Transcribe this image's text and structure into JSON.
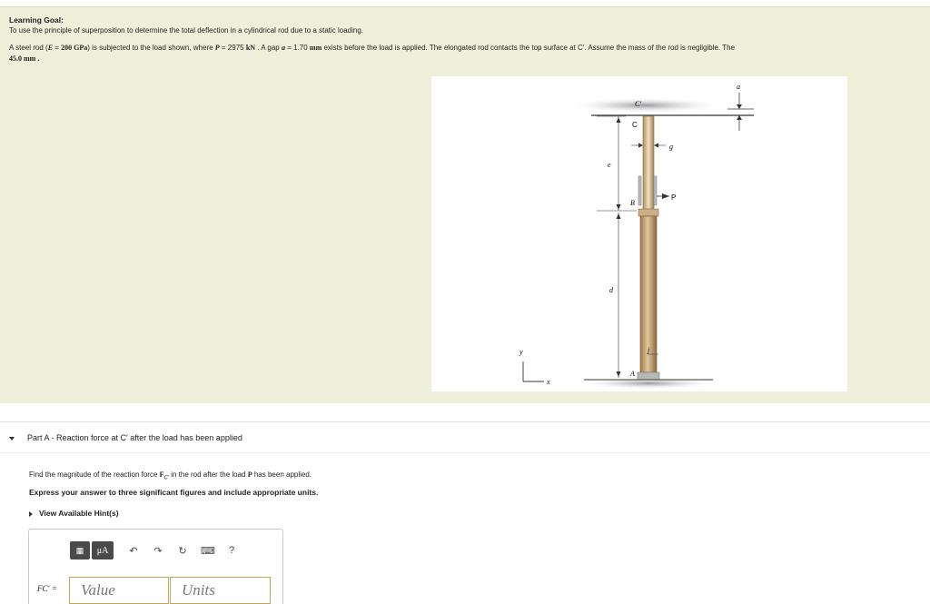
{
  "learning_goal": {
    "title": "Learning Goal:",
    "intro": "To use the principle of superposition to determine the total deflection in a cylindrical rod due to a static loading.",
    "problem": {
      "p1": "A steel rod (",
      "e_sym": "E",
      "p2": " = ",
      "e_val": "200 GPa",
      "p3": ") is subjected to the load shown, where ",
      "p_sym": "P",
      "p4": " = 2975 ",
      "p_unit": "kN",
      "p5": " . A gap ",
      "a_sym": "a",
      "p6": " = 1.70 ",
      "a_unit": "mm",
      "p7": " exists before the load is applied. The elongated rod contacts the top surface at C′. Assume the mass of the rod is negligible. The",
      "line3": "45.0 mm ."
    }
  },
  "figure_labels": {
    "c_prime": "C′",
    "c": "C",
    "a": "a",
    "g": "g",
    "e": "e",
    "b": "B",
    "p": "P",
    "d": "d",
    "y": "y",
    "x": "x",
    "j": "j",
    "a_point": "A"
  },
  "part_a": {
    "header": "Part A - Reaction force at C′ after the load has been applied",
    "question_pre": "Find the magnitude of the reaction force ",
    "question_sym": "F",
    "question_sub": "C′",
    "question_mid": " in the rod after the load ",
    "question_p": "P",
    "question_post": " has been applied.",
    "instruction": "Express your answer to three significant figures and include appropriate units.",
    "hint": "View Available Hint(s)",
    "answer_label": "FC′ =",
    "value_placeholder": "Value",
    "units_placeholder": "Units",
    "toolbar": {
      "templates": "▦",
      "mu": "μA",
      "undo": "↶",
      "redo": "↷",
      "reset": "↻",
      "keyboard": "⌨",
      "help": "?"
    }
  },
  "colors": {
    "goal_bg": "#eef0d9",
    "rod": "#c8a878",
    "field_border": "#c2a45e"
  }
}
